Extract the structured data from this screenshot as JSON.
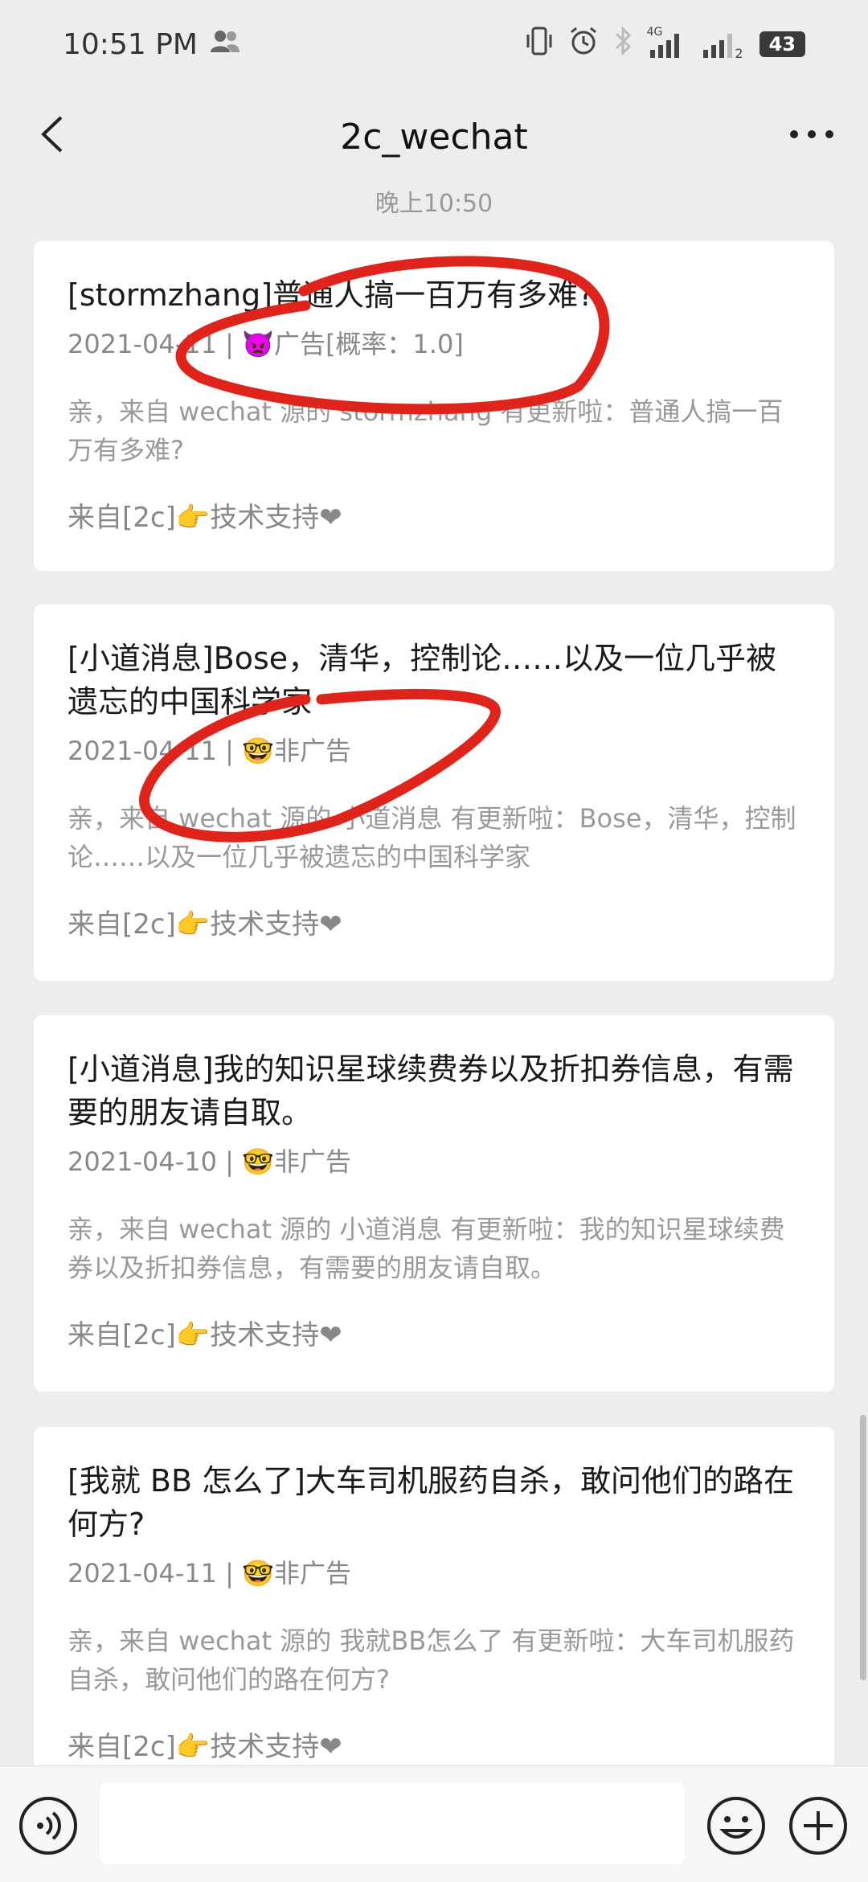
{
  "status_bar": {
    "time": "10:51 PM",
    "network_label": "4G",
    "sim2_label": "2",
    "battery": "43"
  },
  "nav": {
    "title": "2c_wechat"
  },
  "chat": {
    "time_divider": "晚上10:50"
  },
  "cards": [
    {
      "title": "[stormzhang]普通人搞一百万有多难?",
      "meta": "2021-04-11 | 👿广告[概率：1.0]",
      "desc": "亲，来自 wechat 源的 stormzhang 有更新啦：普通人搞一百万有多难?",
      "footer": "来自[2c]👉技术支持❤"
    },
    {
      "title": "[小道消息]Bose，清华，控制论……以及一位几乎被遗忘的中国科学家",
      "meta": "2021-04-11 | 🤓非广告",
      "desc": "亲，来自 wechat 源的 小道消息 有更新啦：Bose，清华，控制论……以及一位几乎被遗忘的中国科学家",
      "footer": "来自[2c]👉技术支持❤"
    },
    {
      "title": "[小道消息]我的知识星球续费券以及折扣券信息，有需要的朋友请自取。",
      "meta": "2021-04-10 | 🤓非广告",
      "desc": "亲，来自 wechat 源的 小道消息 有更新啦：我的知识星球续费券以及折扣券信息，有需要的朋友请自取。",
      "footer": "来自[2c]👉技术支持❤"
    },
    {
      "title": "[我就 BB 怎么了]大车司机服药自杀，敢问他们的路在何方?",
      "meta": "2021-04-11 | 🤓非广告",
      "desc": "亲，来自 wechat 源的 我就BB怎么了 有更新啦：大车司机服药自杀，敢问他们的路在何方?",
      "footer": "来自[2c]👉技术支持❤"
    }
  ],
  "input_bar": {
    "placeholder": ""
  },
  "colors": {
    "annotation": "#e0241b",
    "background": "#ededed"
  }
}
